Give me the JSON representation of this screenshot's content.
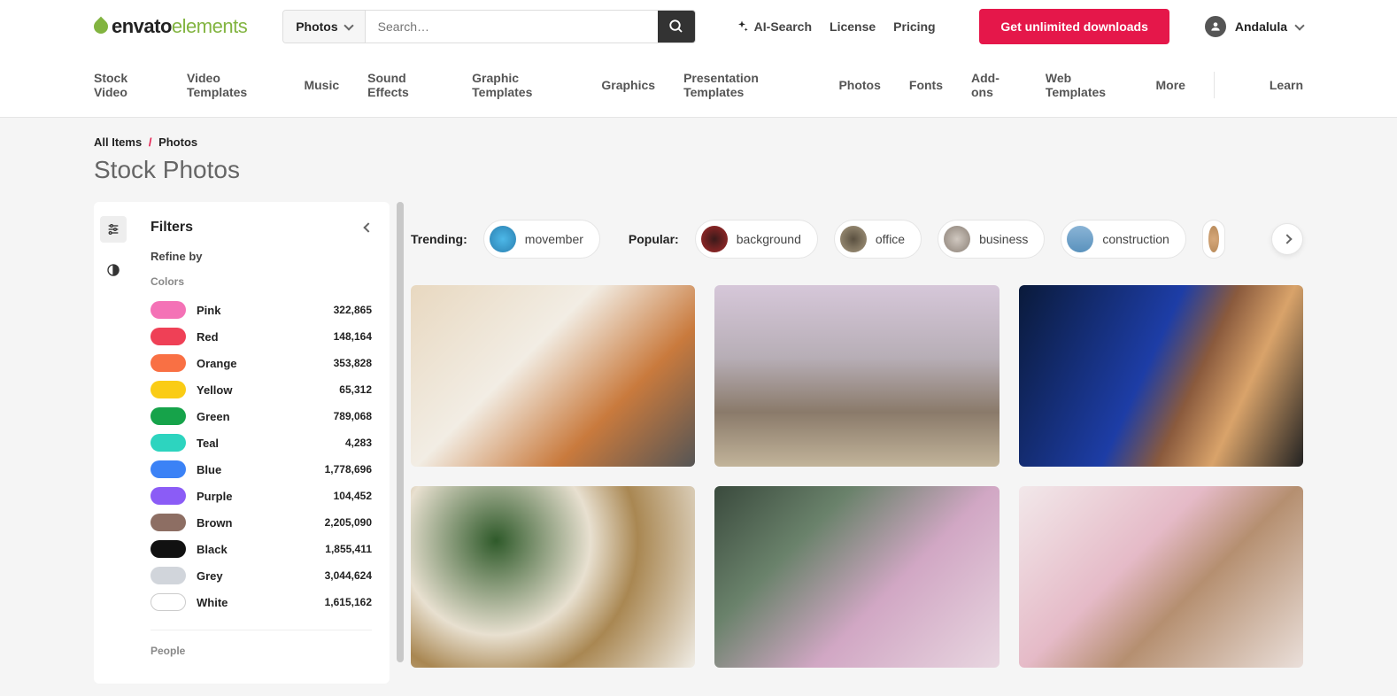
{
  "header": {
    "logo": {
      "part1": "envato",
      "part2": "elements"
    },
    "search": {
      "category": "Photos",
      "placeholder": "Search…"
    },
    "ai_search": "AI-Search",
    "license": "License",
    "pricing": "Pricing",
    "cta": "Get unlimited downloads",
    "user": "Andalula"
  },
  "nav": {
    "items": [
      "Stock Video",
      "Video Templates",
      "Music",
      "Sound Effects",
      "Graphic Templates",
      "Graphics",
      "Presentation Templates",
      "Photos",
      "Fonts",
      "Add-ons",
      "Web Templates",
      "More"
    ],
    "learn": "Learn"
  },
  "breadcrumb": {
    "root": "All Items",
    "current": "Photos"
  },
  "page_title": "Stock Photos",
  "filters": {
    "title": "Filters",
    "refine_label": "Refine by",
    "colors_label": "Colors",
    "people_label": "People",
    "colors": [
      {
        "name": "Pink",
        "count": "322,865",
        "hex": "#f472b6"
      },
      {
        "name": "Red",
        "count": "148,164",
        "hex": "#ef4056"
      },
      {
        "name": "Orange",
        "count": "353,828",
        "hex": "#f97044"
      },
      {
        "name": "Yellow",
        "count": "65,312",
        "hex": "#facc15"
      },
      {
        "name": "Green",
        "count": "789,068",
        "hex": "#16a34a"
      },
      {
        "name": "Teal",
        "count": "4,283",
        "hex": "#2dd4bf"
      },
      {
        "name": "Blue",
        "count": "1,778,696",
        "hex": "#3b82f6"
      },
      {
        "name": "Purple",
        "count": "104,452",
        "hex": "#8b5cf6"
      },
      {
        "name": "Brown",
        "count": "2,205,090",
        "hex": "#8d6e63"
      },
      {
        "name": "Black",
        "count": "1,855,411",
        "hex": "#111111"
      },
      {
        "name": "Grey",
        "count": "3,044,624",
        "hex": "#d1d5db"
      },
      {
        "name": "White",
        "count": "1,615,162",
        "hex": "#ffffff"
      }
    ]
  },
  "tags": {
    "trending_label": "Trending:",
    "popular_label": "Popular:",
    "trending": [
      {
        "label": "movember",
        "class": "tagc-movember"
      }
    ],
    "popular": [
      {
        "label": "background",
        "class": "tagc-background"
      },
      {
        "label": "office",
        "class": "tagc-office"
      },
      {
        "label": "business",
        "class": "tagc-business"
      },
      {
        "label": "construction",
        "class": "tagc-construction"
      }
    ]
  }
}
